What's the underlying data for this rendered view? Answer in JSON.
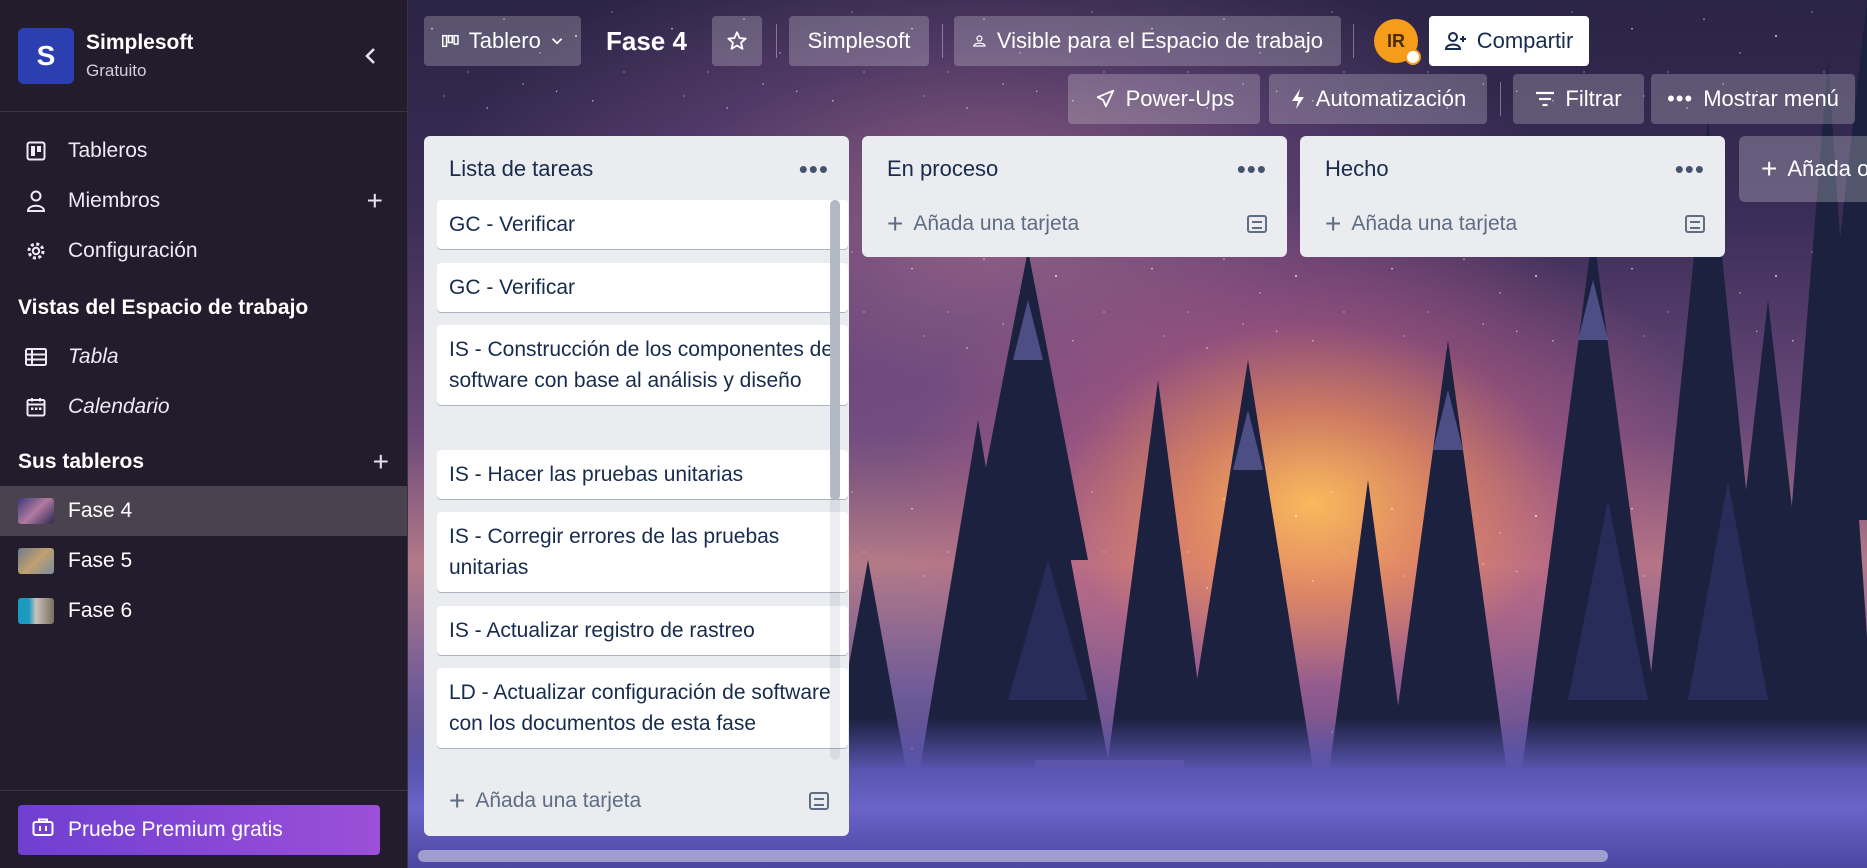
{
  "workspace": {
    "initial": "S",
    "name": "Simplesoft",
    "plan": "Gratuito"
  },
  "sidebar": {
    "nav": [
      {
        "label": "Tableros",
        "icon": "board-icon"
      },
      {
        "label": "Miembros",
        "icon": "person-icon"
      },
      {
        "label": "Configuración",
        "icon": "gear-icon"
      }
    ],
    "views_title": "Vistas del Espacio de trabajo",
    "views": [
      {
        "label": "Tabla",
        "icon": "table-icon"
      },
      {
        "label": "Calendario",
        "icon": "calendar-icon"
      }
    ],
    "boards_title": "Sus tableros",
    "boards": [
      {
        "label": "Fase 4",
        "active": true
      },
      {
        "label": "Fase 5",
        "active": false
      },
      {
        "label": "Fase 6",
        "active": false
      }
    ],
    "premium_label": "Pruebe Premium gratis"
  },
  "header": {
    "view_switcher": "Tablero",
    "board_title": "Fase 4",
    "workspace_button": "Simplesoft",
    "visibility": "Visible para el Espacio de trabajo",
    "avatar_initials": "IR",
    "share": "Compartir",
    "powerups": "Power-Ups",
    "automation": "Automatización",
    "filter": "Filtrar",
    "menu": "Mostrar menú"
  },
  "lists": [
    {
      "title": "Lista de tareas",
      "cards": [
        "GC - Verificar",
        "GC - Verificar",
        "IS - Construcción de los componentes de software con base al análisis y diseño",
        "IS - Hacer las pruebas unitarias",
        "IS - Corregir errores de las pruebas unitarias",
        "IS - Actualizar registro de rastreo",
        "LD - Actualizar configuración de software con los documentos de esta fase"
      ],
      "add_card": "Añada una tarjeta"
    },
    {
      "title": "En proceso",
      "cards": [],
      "add_card": "Añada una tarjeta"
    },
    {
      "title": "Hecho",
      "cards": [],
      "add_card": "Añada una tarjeta"
    }
  ],
  "add_list": "Añada o",
  "colors": {
    "sidebar_bg": "#231c2c",
    "workspace_logo": "#2c3fb1",
    "premium_gradient_start": "#6f3fd1",
    "premium_gradient_end": "#9c4fd8",
    "list_bg": "#ebecf0",
    "avatar": "#f59c1a"
  }
}
